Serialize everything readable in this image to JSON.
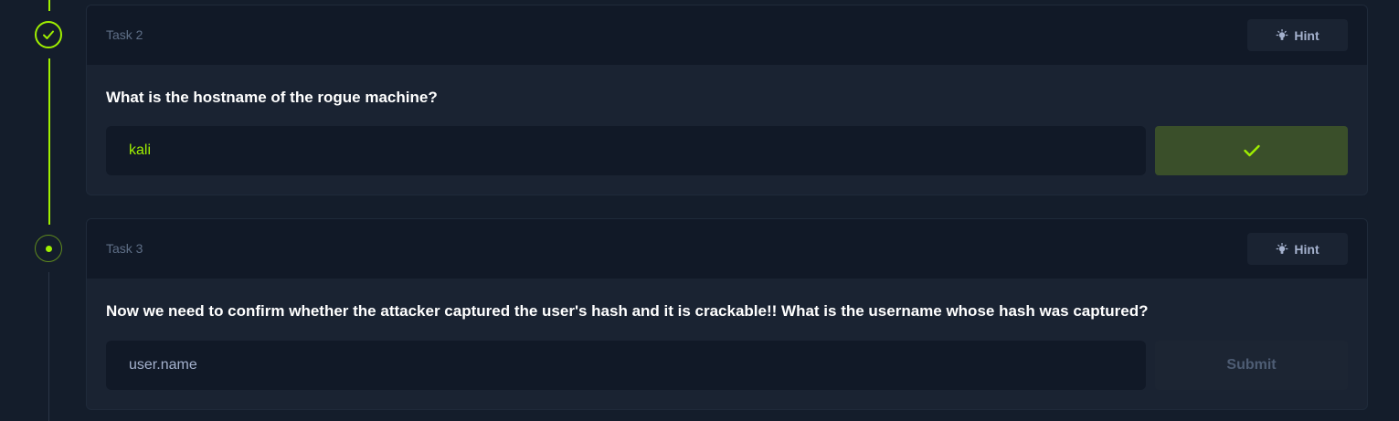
{
  "tasks": [
    {
      "label": "Task 2",
      "hint_label": "Hint",
      "question": "What is the hostname of the rogue machine?",
      "answer": "kali",
      "status": "complete"
    },
    {
      "label": "Task 3",
      "hint_label": "Hint",
      "question": "Now we need to confirm whether the attacker captured the user's hash and it is crackable!! What is the username whose hash was captured?",
      "answer": "user.name",
      "submit_label": "Submit",
      "status": "pending"
    }
  ],
  "colors": {
    "accent": "#9fef00",
    "background": "#141d2b",
    "card_header": "#111927",
    "card_body": "#1a2332",
    "success_button": "#3a4f2a"
  },
  "icons": {
    "complete_node": "check-icon",
    "current_node": "dot-icon",
    "hint": "lightbulb-icon",
    "correct": "check-icon"
  }
}
